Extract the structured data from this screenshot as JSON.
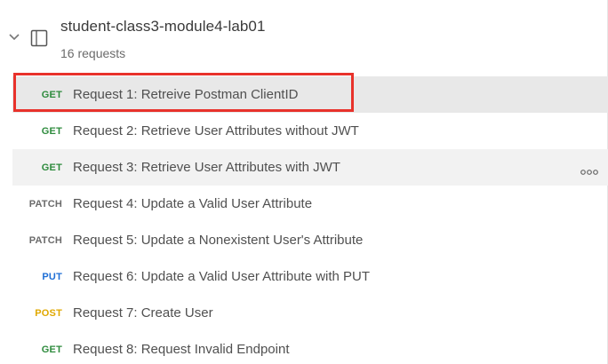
{
  "collection": {
    "name": "student-class3-module4-lab01",
    "meta": "16 requests",
    "chevron_icon": "chevron-down-icon",
    "folder_icon": "collection-icon"
  },
  "colors": {
    "GET": "#2e8b3d",
    "PATCH": "#6b6b6b",
    "PUT": "#1f6fd6",
    "POST": "#e0a800",
    "highlight": "#e8322b",
    "active_row": "#e8e8e8"
  },
  "requests": [
    {
      "method": "GET",
      "name": "Request 1: Retreive Postman ClientID",
      "state": "active"
    },
    {
      "method": "GET",
      "name": "Request 2: Retrieve User Attributes without JWT",
      "state": ""
    },
    {
      "method": "GET",
      "name": "Request 3: Retrieve User Attributes with JWT",
      "state": "hovered"
    },
    {
      "method": "PATCH",
      "name": "Request 4: Update a Valid User Attribute",
      "state": ""
    },
    {
      "method": "PATCH",
      "name": "Request 5: Update a Nonexistent User's Attribute",
      "state": ""
    },
    {
      "method": "PUT",
      "name": "Request 6: Update a Valid User Attribute with PUT",
      "state": ""
    },
    {
      "method": "POST",
      "name": "Request 7: Create User",
      "state": ""
    },
    {
      "method": "GET",
      "name": "Request 8: Request Invalid Endpoint",
      "state": ""
    }
  ],
  "more_actions_icon": "more-options-icon"
}
